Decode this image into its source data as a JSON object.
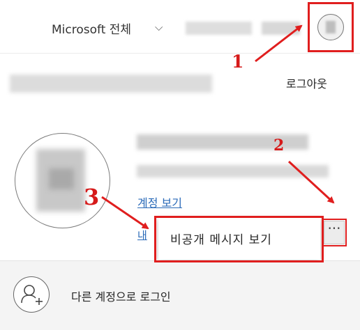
{
  "header": {
    "scope_label": "Microsoft 전체",
    "scope_chevron": "⌵"
  },
  "account": {
    "signout_label": "로그아웃",
    "view_account_link": "계정 보기",
    "partial_link": "내"
  },
  "more_menu": {
    "button_glyph": "···",
    "item_label": "비공개 메시지 보기"
  },
  "footer": {
    "other_account_label": "다른 계정으로 로그인"
  },
  "annotations": {
    "step1": "1",
    "step2": "2",
    "step3": "3",
    "color": "#e01e1e"
  },
  "icons": {
    "avatar": "avatar-icon",
    "add_user": "add-user-icon",
    "chevron": "chevron-down-icon",
    "more": "more-icon"
  }
}
